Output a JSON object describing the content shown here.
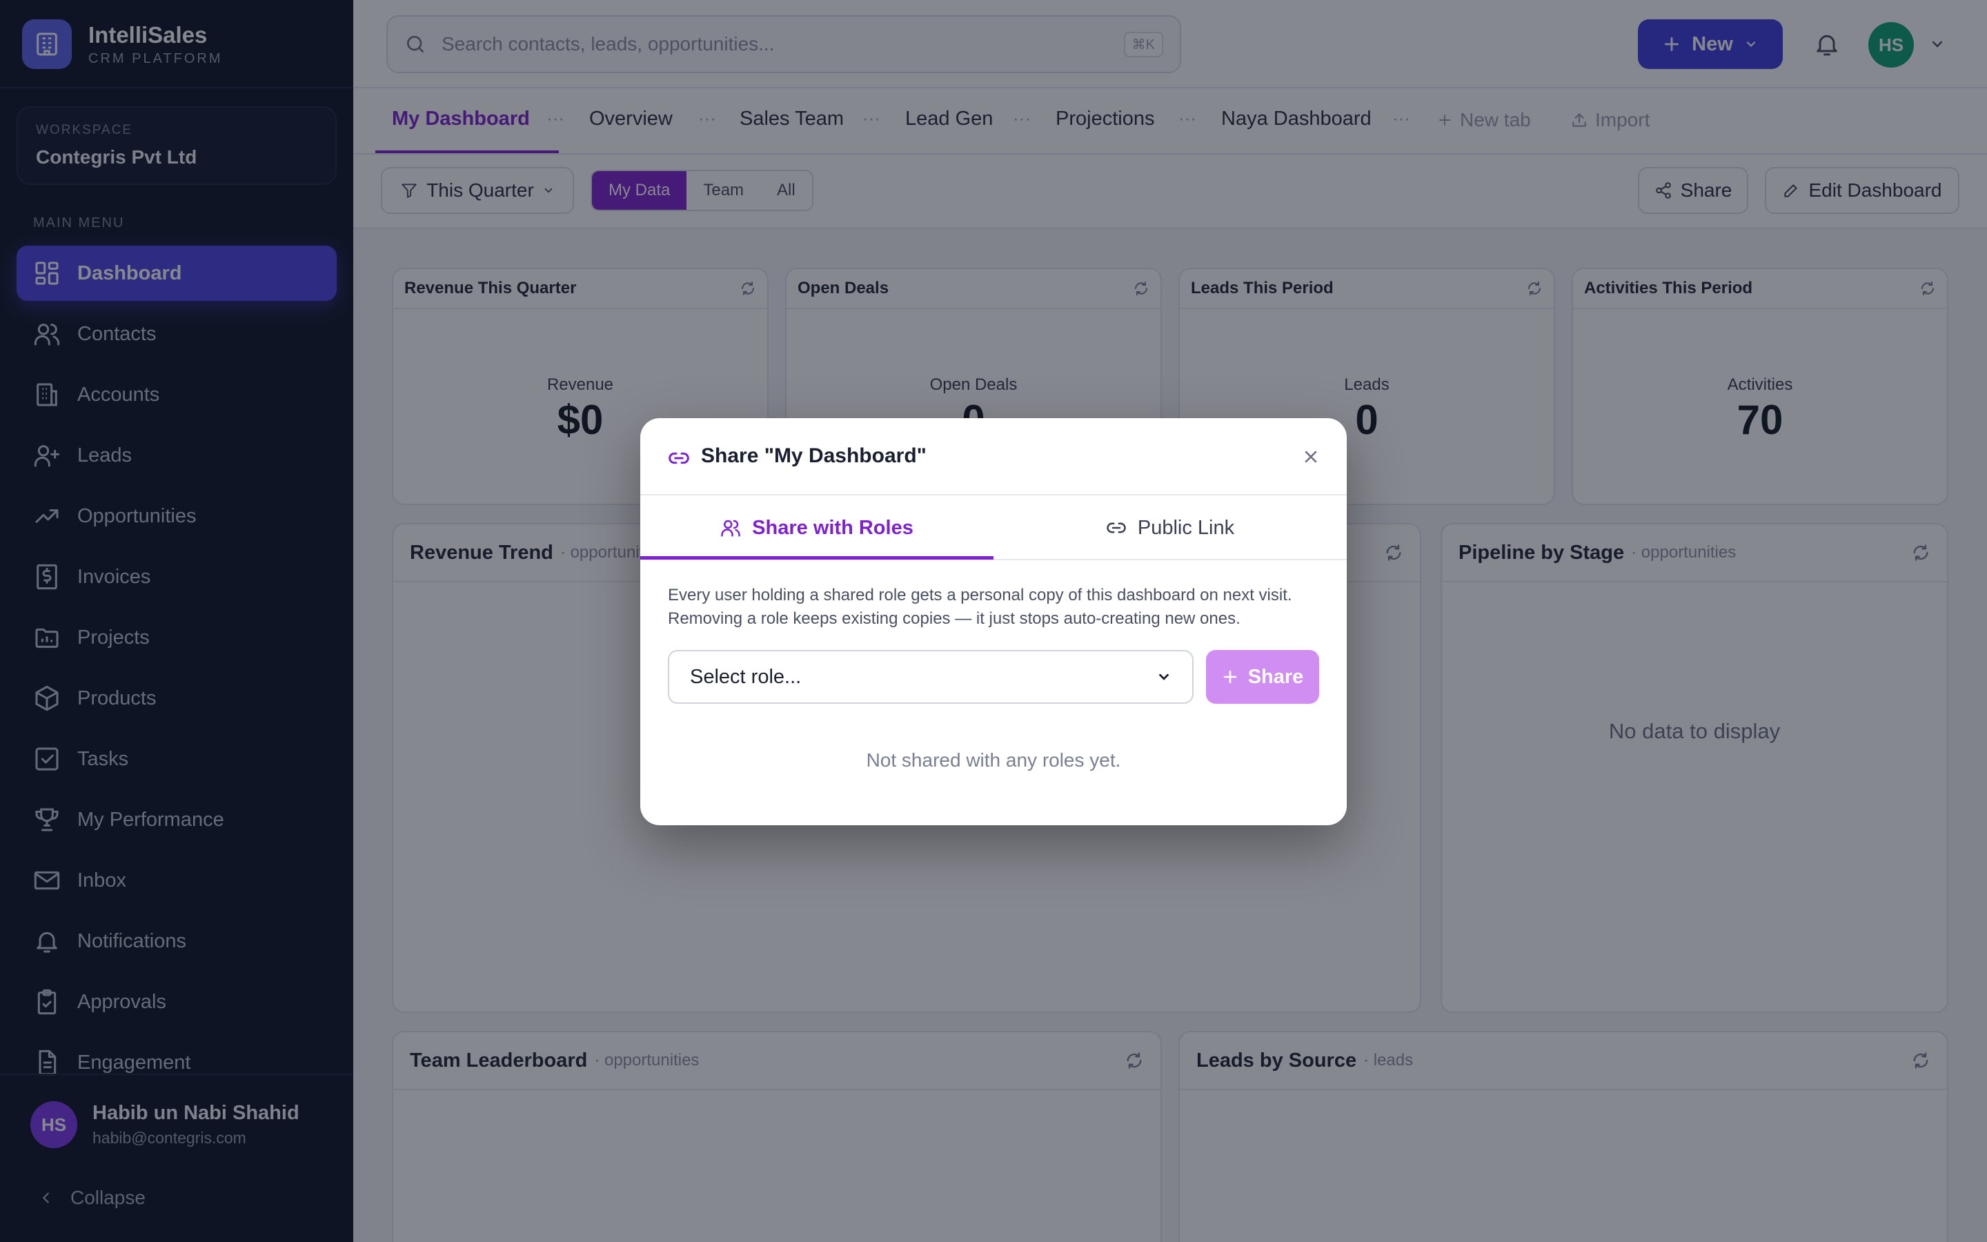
{
  "brand": {
    "name": "IntelliSales",
    "subtitle": "CRM PLATFORM"
  },
  "workspace": {
    "label": "WORKSPACE",
    "name": "Contegris Pvt Ltd"
  },
  "sidebar": {
    "menu_label": "MAIN MENU",
    "items": [
      {
        "label": "Dashboard",
        "icon": "grid-icon",
        "active": true
      },
      {
        "label": "Contacts",
        "icon": "users-icon"
      },
      {
        "label": "Accounts",
        "icon": "building-icon"
      },
      {
        "label": "Leads",
        "icon": "user-plus-icon"
      },
      {
        "label": "Opportunities",
        "icon": "trending-up-icon"
      },
      {
        "label": "Invoices",
        "icon": "invoice-icon"
      },
      {
        "label": "Projects",
        "icon": "folder-icon"
      },
      {
        "label": "Products",
        "icon": "box-icon"
      },
      {
        "label": "Tasks",
        "icon": "checkbox-icon"
      },
      {
        "label": "My Performance",
        "icon": "trophy-icon"
      },
      {
        "label": "Inbox",
        "icon": "mail-icon"
      },
      {
        "label": "Notifications",
        "icon": "bell-icon"
      },
      {
        "label": "Approvals",
        "icon": "clipboard-check-icon"
      },
      {
        "label": "Engagement",
        "icon": "document-icon"
      }
    ],
    "user": {
      "initials": "HS",
      "name": "Habib un Nabi Shahid",
      "email": "habib@contegris.com"
    },
    "collapse_label": "Collapse"
  },
  "topbar": {
    "search_placeholder": "Search contacts, leads, opportunities...",
    "search_shortcut": "⌘K",
    "new_label": "New",
    "avatar_initials": "HS"
  },
  "tabs": {
    "items": [
      "My Dashboard",
      "Overview",
      "Sales Team",
      "Lead Gen",
      "Projections",
      "Naya Dashboard"
    ],
    "new_tab_label": "New tab",
    "import_label": "Import"
  },
  "filters": {
    "period": "This Quarter",
    "scope": [
      "My Data",
      "Team",
      "All"
    ],
    "scope_selected": "My Data",
    "share_label": "Share",
    "edit_label": "Edit Dashboard"
  },
  "kpis": [
    {
      "title": "Revenue This Quarter",
      "label": "Revenue",
      "value": "$0"
    },
    {
      "title": "Open Deals",
      "label": "Open Deals",
      "value": "0"
    },
    {
      "title": "Leads This Period",
      "label": "Leads",
      "value": "0"
    },
    {
      "title": "Activities This Period",
      "label": "Activities",
      "value": "70"
    }
  ],
  "widgets": {
    "revenue_trend": {
      "title": "Revenue Trend",
      "sub": "· opportunities"
    },
    "pipeline": {
      "title": "Pipeline by Stage",
      "sub": "· opportunities",
      "empty": "No data to display"
    },
    "leaderboard": {
      "title": "Team Leaderboard",
      "sub": "· opportunities"
    },
    "sources": {
      "title": "Leads by Source",
      "sub": "· leads"
    }
  },
  "modal": {
    "title": "Share \"My Dashboard\"",
    "tab_roles": "Share with Roles",
    "tab_public": "Public Link",
    "description_line1": "Every user holding a shared role gets a personal copy of this dashboard on next visit.",
    "description_line2": "Removing a role keeps existing copies — it just stops auto-creating new ones.",
    "select_placeholder": "Select role...",
    "share_button": "Share",
    "empty_text": "Not shared with any roles yet."
  },
  "colors": {
    "accent": "#7e22ce",
    "primary": "#4f46e5",
    "sidebar_bg": "#111729"
  }
}
